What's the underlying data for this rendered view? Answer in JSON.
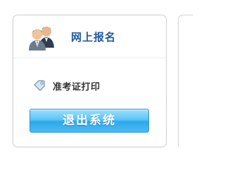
{
  "header": {
    "title": "网上报名",
    "avatar_icon": "users-icon"
  },
  "menu": {
    "items": [
      {
        "label": "准考证打印",
        "icon": "tag-icon"
      }
    ]
  },
  "actions": {
    "logout_label": "退出系统"
  },
  "colors": {
    "title": "#1f5aa0",
    "button_top": "#9fe0ff",
    "button_bottom": "#2ea8ec",
    "panel_border": "#cfd3d8"
  }
}
